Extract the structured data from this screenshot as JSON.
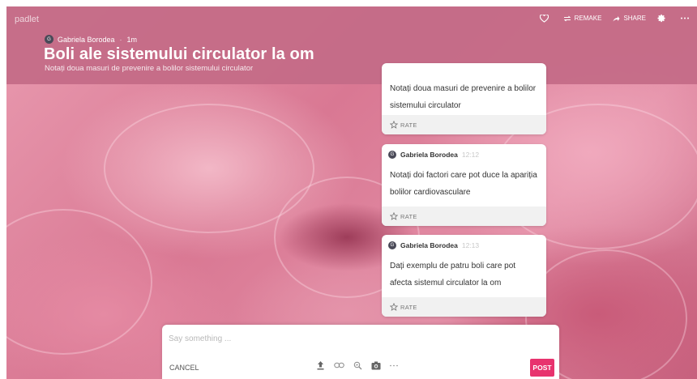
{
  "app": {
    "brand": "padlet"
  },
  "header": {
    "author": "Gabriela Borodea",
    "author_initial": "G",
    "age": "1m",
    "title": "Boli ale sistemului circulator la om",
    "subtitle": "Notați doua masuri de prevenire a bolilor sistemului circulator"
  },
  "toolbar": {
    "remake": "REMAKE",
    "share": "SHARE"
  },
  "cards": [
    {
      "text": "Notați doua masuri de prevenire a bolilor sistemului circulator",
      "rate": "RATE"
    },
    {
      "author": "Gabriela Borodea",
      "initial": "G",
      "time": "12:12",
      "text": "Notați doi factori care pot duce la apariția bolilor cardiovasculare",
      "rate": "RATE"
    },
    {
      "author": "Gabriela Borodea",
      "initial": "G",
      "time": "12:13",
      "text": "Dați exemplu de patru boli care pot afecta sistemul circulator la om",
      "rate": "RATE"
    }
  ],
  "composer": {
    "placeholder": "Say something ...",
    "value": "",
    "cancel": "CANCEL",
    "post": "POST",
    "tools": [
      "upload-icon",
      "link-icon",
      "search-image-icon",
      "camera-icon",
      "more-icon"
    ]
  },
  "colors": {
    "header": "#c46c87",
    "post": "#e8336e"
  }
}
